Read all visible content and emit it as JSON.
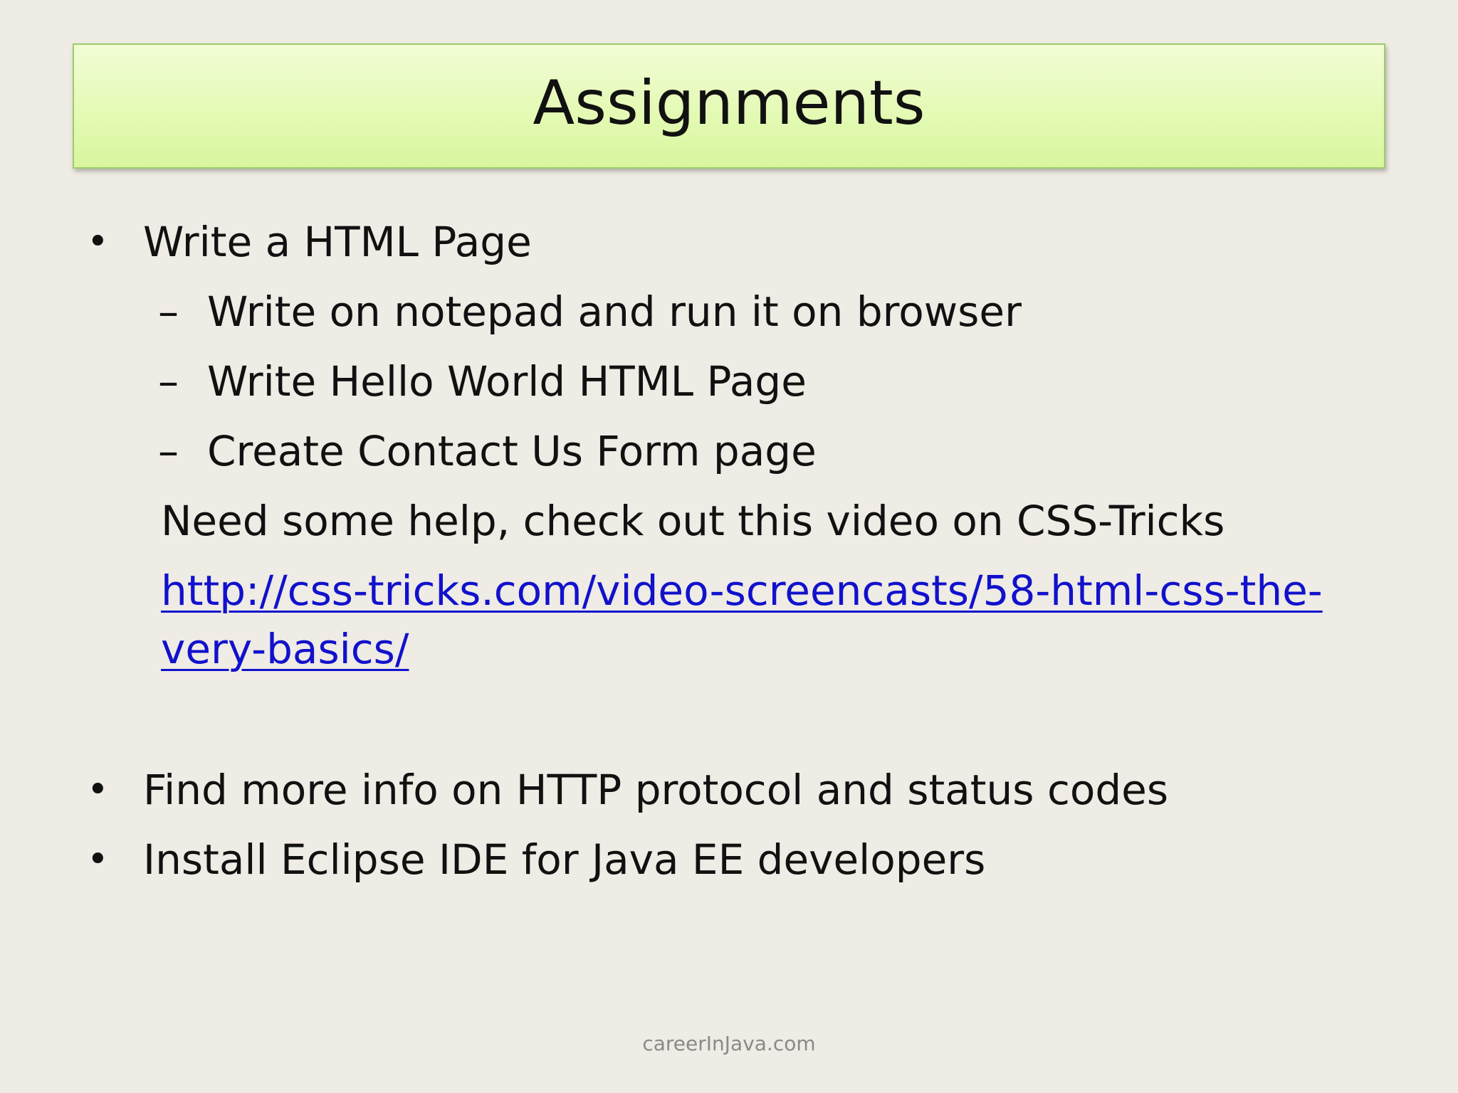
{
  "slide": {
    "title": "Assignments",
    "bullets": [
      {
        "text": "Write a HTML Page",
        "subitems": [
          "Write on notepad and run it on browser",
          "Write Hello World HTML Page",
          "Create Contact Us Form page"
        ],
        "note": "Need some help, check out this video on CSS-Tricks",
        "link_line1": "http://css-tricks.com/video-screencasts/58-html-css-the-",
        "link_line2": "very-basics/"
      },
      {
        "text": "Find more info on HTTP protocol and status codes"
      },
      {
        "text": "Install Eclipse IDE for Java EE developers"
      }
    ],
    "bullet_symbol": "•",
    "dash_symbol": "–",
    "footer": "careerInJava.com"
  },
  "colors": {
    "background": "#efebe5",
    "title_fill": "#e4fab5",
    "title_border": "#9ccd6a",
    "link": "#1111cc",
    "footer": "#8a8a8a"
  }
}
